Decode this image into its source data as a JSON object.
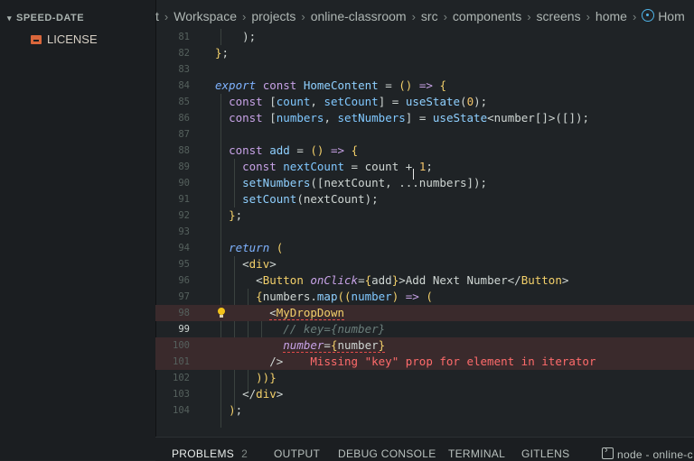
{
  "sidebar": {
    "section_title": "SPEED-DATE",
    "files": [
      {
        "name": "LICENSE"
      }
    ]
  },
  "breadcrumb": {
    "segments": [
      "t",
      "Workspace",
      "projects",
      "online-classroom",
      "src",
      "components",
      "screens",
      "home",
      "Hom"
    ]
  },
  "editor": {
    "line_numbers": [
      "81",
      "82",
      "83",
      "84",
      "85",
      "86",
      "87",
      "88",
      "89",
      "90",
      "91",
      "92",
      "93",
      "94",
      "95",
      "96",
      "97",
      "98",
      "99",
      "100",
      "101",
      "102",
      "103",
      "104"
    ],
    "active_line": "99",
    "error_message": "Missing \"key\" prop for element in iterator"
  },
  "panel": {
    "tabs": [
      {
        "label": "PROBLEMS",
        "badge": "2"
      },
      {
        "label": "OUTPUT"
      },
      {
        "label": "DEBUG CONSOLE"
      },
      {
        "label": "TERMINAL"
      },
      {
        "label": "GITLENS"
      }
    ],
    "terminal_label": "node - online-c"
  },
  "colors": {
    "background": "#1f2326",
    "error": "#ff6b6b",
    "keyword": "#c7a2e6",
    "identifier": "#80c8ff",
    "jsx_tag": "#f3d06a"
  }
}
